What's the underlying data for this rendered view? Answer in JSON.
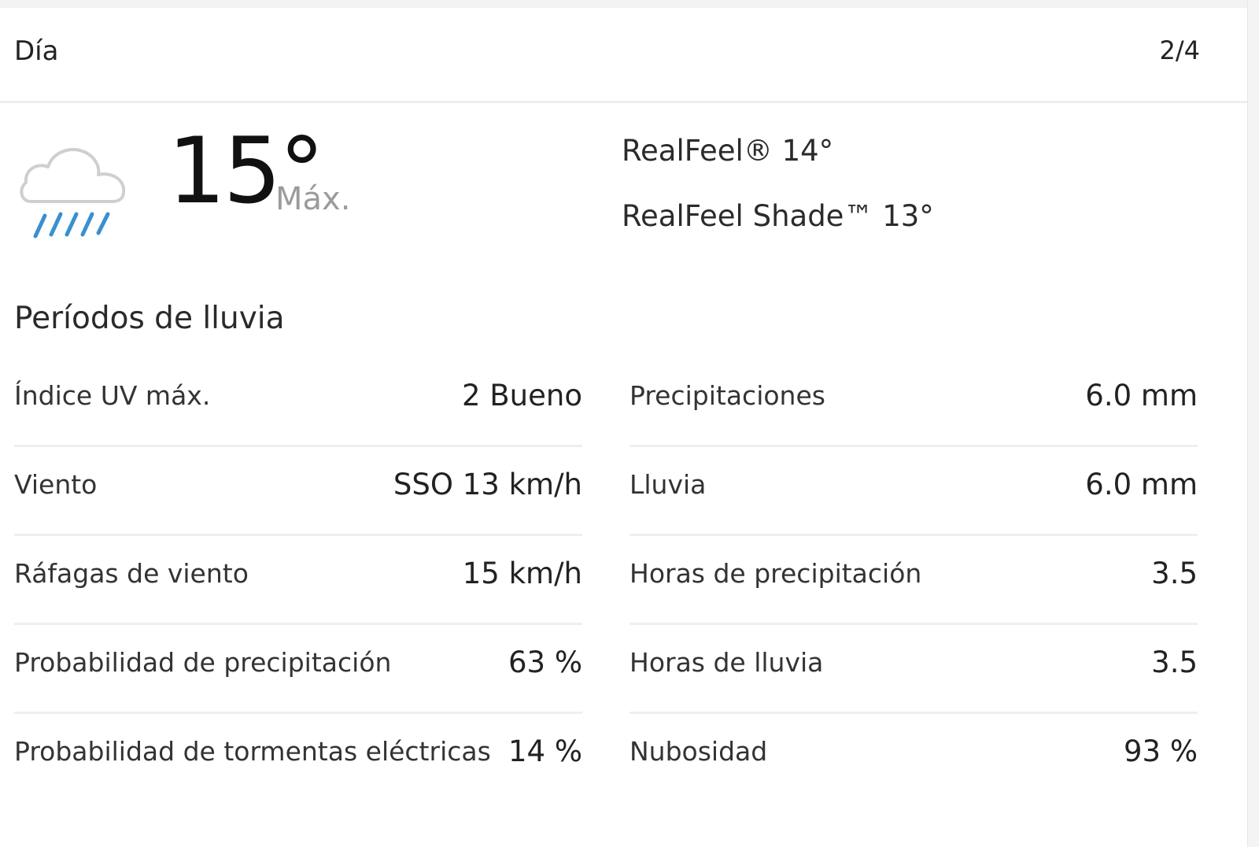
{
  "header": {
    "label": "Día",
    "counter": "2/4"
  },
  "current": {
    "icon": "rain-cloud-icon",
    "temperature": "15°",
    "temp_label": "Máx.",
    "realfeel": "RealFeel® 14°",
    "realfeel_shade": "RealFeel Shade™ 13°",
    "phrase": "Períodos de lluvia"
  },
  "details": {
    "left": [
      {
        "label": "Índice UV máx.",
        "value": "2 Bueno"
      },
      {
        "label": "Viento",
        "value": "SSO 13 km/h"
      },
      {
        "label": "Ráfagas de viento",
        "value": "15 km/h"
      },
      {
        "label": "Probabilidad de precipitación",
        "value": "63 %"
      },
      {
        "label": "Probabilidad de tormentas eléctricas",
        "value": "14 %"
      }
    ],
    "right": [
      {
        "label": "Precipitaciones",
        "value": "6.0 mm"
      },
      {
        "label": "Lluvia",
        "value": "6.0 mm"
      },
      {
        "label": "Horas de precipitación",
        "value": "3.5"
      },
      {
        "label": "Horas de lluvia",
        "value": "3.5"
      },
      {
        "label": "Nubosidad",
        "value": "93 %"
      }
    ]
  },
  "colors": {
    "rain": "#3a8fd0",
    "cloud_outline": "#d0d0d0",
    "muted_text": "#9b9b9b",
    "divider": "#efefef"
  }
}
